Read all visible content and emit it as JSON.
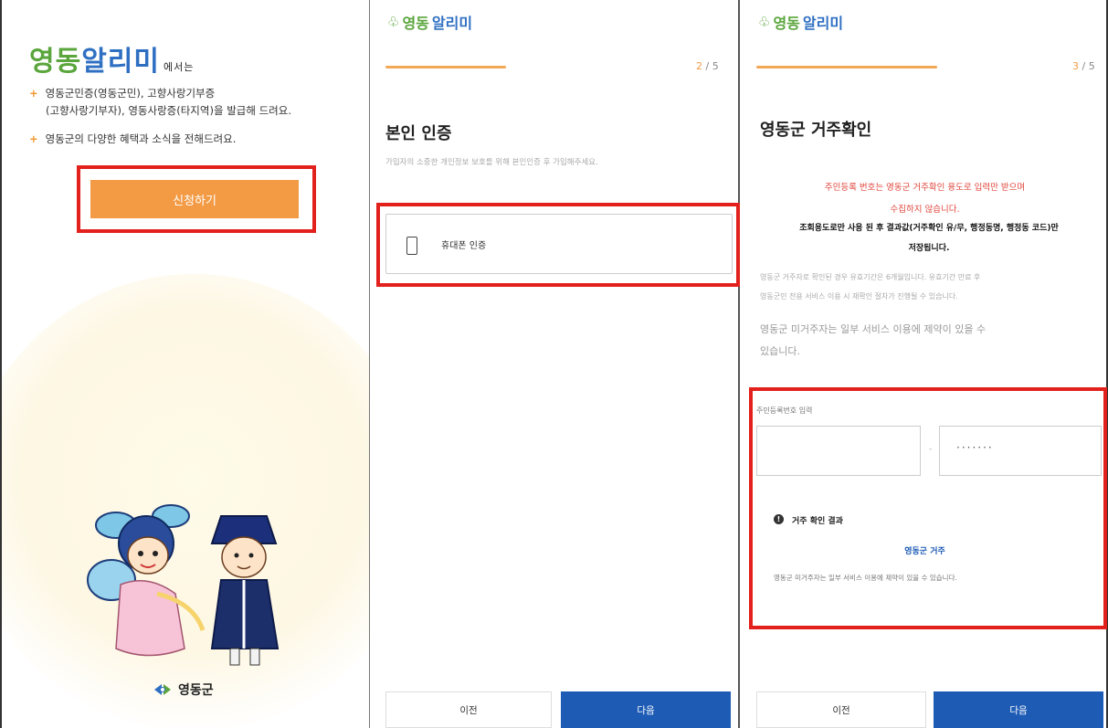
{
  "panel1": {
    "brand_part1": "영동",
    "brand_part2": "알리미",
    "brand_suffix": "에서는",
    "bullet1_line1": "영동군민증(영동군민), 고향사랑기부증",
    "bullet1_line2": "(고향사랑기부자), 영동사랑증(타지역)을 발급해 드려요.",
    "bullet2": "영동군의 다양한 혜택과 소식을 전해드려요.",
    "apply_button": "신청하기",
    "county_name": "영동군"
  },
  "panel2": {
    "logo_part1": "영동",
    "logo_part2": "알리미",
    "step_current": "2",
    "step_total": " / 5",
    "title": "본인 인증",
    "subtitle": "가입자의 소중한 개인정보 보호를 위해 본인인증 후 가입해주세요.",
    "auth_option": "휴대폰 인증",
    "prev_button": "이전",
    "next_button": "다음"
  },
  "panel3": {
    "logo_part1": "영동",
    "logo_part2": "알리미",
    "step_current": "3",
    "step_total": " / 5",
    "title": "영동군 거주확인",
    "notice_red_line1": "주민등록 번호는 영동군 거주확인 용도로 입력만 받으며",
    "notice_red_line2": "수집하지 않습니다.",
    "notice_black_line1": "조회용도로만 사용 된 후 결과값(거주확인 유/무, 행정동명, 행정동 코드)만",
    "notice_black_line2": "저장됩니다.",
    "gray_line1": "영동군 거주자로 확인된 경우 유효기간은 6개월입니다. 유효기간 만료 후",
    "gray_line2": "영동군민 전용 서비스 이용 시 재확인 절차가 진행될 수 있습니다.",
    "gray_mid_line1": "영동군 미거주자는 일부 서비스 이용에 제약이 있을 수",
    "gray_mid_line2": "있습니다.",
    "field_label": "주민등록번호 입력",
    "rrn_front_value": "",
    "rrn_back_value": "·······",
    "result_title": "거주 확인 결과",
    "result_value": "영동군 거주",
    "result_note": "영동군 미거주자는 일부 서비스 이용에 제약이 있을 수 있습니다.",
    "prev_button": "이전",
    "next_button": "다음"
  },
  "colors": {
    "accent_orange": "#f39a44",
    "brand_green": "#5aa53c",
    "brand_blue": "#2f6fc2",
    "next_button_blue": "#1d5bb5",
    "highlight_red": "#e3211c",
    "notice_red": "#e0453b"
  }
}
